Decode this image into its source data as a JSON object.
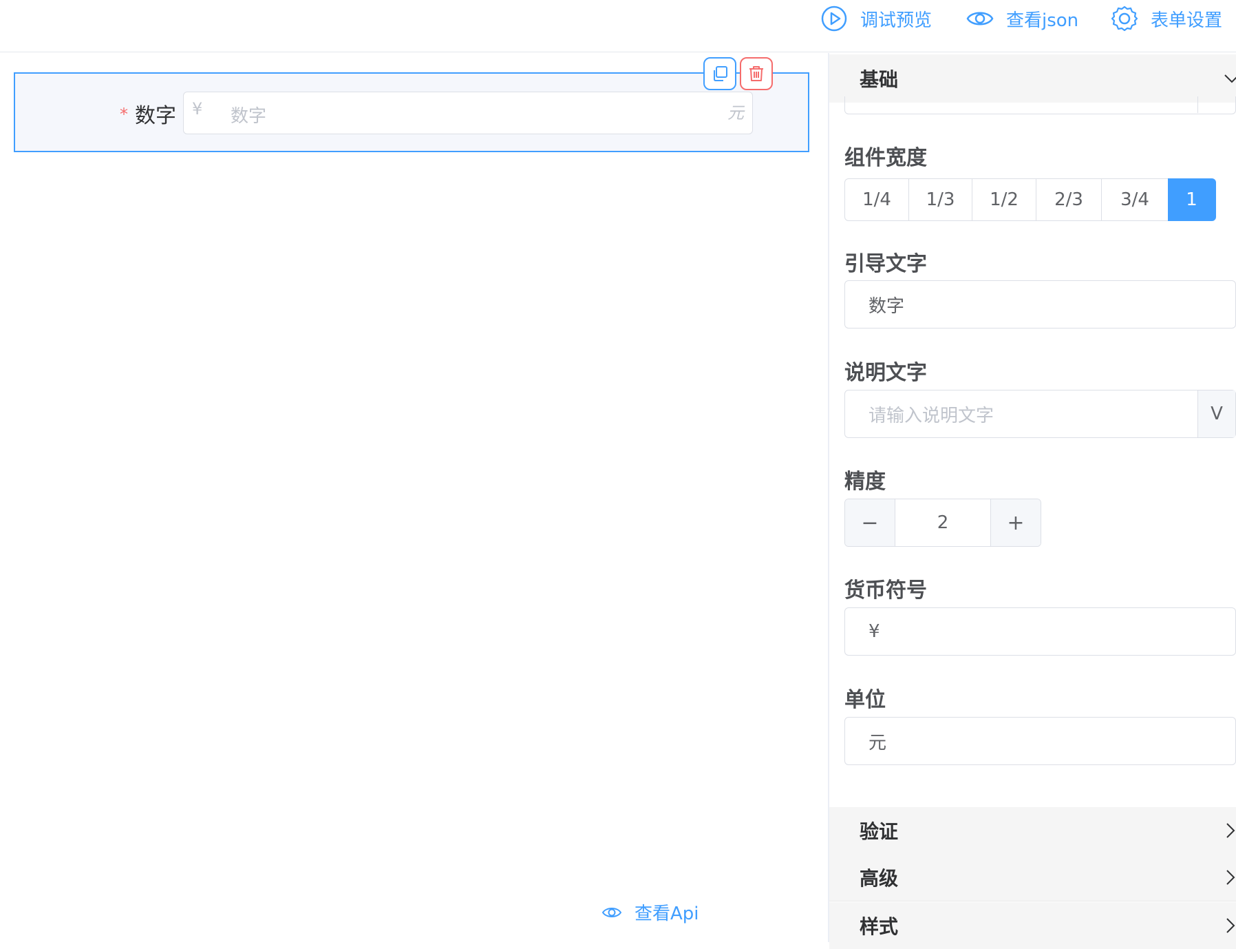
{
  "toolbar": {
    "preview_label": "调试预览",
    "json_label": "查看json",
    "settings_label": "表单设置"
  },
  "canvas": {
    "field": {
      "required_mark": "*",
      "label": "数字",
      "prefix": "¥",
      "placeholder": "数字",
      "suffix": "元"
    },
    "view_api_label": "查看Api"
  },
  "panel": {
    "sections": {
      "basic": "基础",
      "validate": "验证",
      "advanced": "高级",
      "style": "样式"
    },
    "width": {
      "label": "组件宽度",
      "options": [
        "1/4",
        "1/3",
        "1/2",
        "2/3",
        "3/4",
        "1"
      ],
      "selected": "1"
    },
    "guide_text": {
      "label": "引导文字",
      "value": "数字"
    },
    "description": {
      "label": "说明文字",
      "placeholder": "请输入说明文字",
      "append": "V"
    },
    "precision": {
      "label": "精度",
      "value": "2",
      "minus": "−",
      "plus": "+"
    },
    "currency": {
      "label": "货币符号",
      "value": "¥"
    },
    "unit": {
      "label": "单位",
      "value": "元"
    }
  },
  "colors": {
    "primary": "#409eff",
    "danger": "#f56c6c"
  }
}
